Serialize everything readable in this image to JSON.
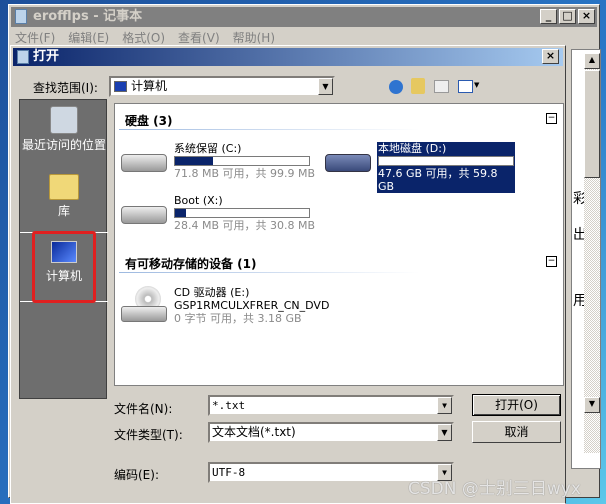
{
  "notepad": {
    "title": "erofflps - 记事本",
    "menu": [
      "文件(F)",
      "编辑(E)",
      "格式(O)",
      "查看(V)",
      "帮助(H)"
    ],
    "text_fragments": [
      "彩",
      "出",
      "用"
    ]
  },
  "dialog": {
    "title": "打开",
    "look_in_label": "查找范围(I):",
    "look_in_value": "计算机",
    "places": [
      {
        "label": "最近访问的位置",
        "icon": "recent-places-icon"
      },
      {
        "label": "库",
        "icon": "library-icon"
      },
      {
        "label": "计算机",
        "icon": "computer-icon",
        "selected": true
      }
    ],
    "groups": [
      {
        "title": "硬盘 (3)",
        "drives": [
          {
            "name": "系统保留 (C:)",
            "info": "71.8 MB 可用，共 99.9 MB",
            "used_fraction": 0.28
          },
          {
            "name": "本地磁盘 (D:)",
            "info": "47.6 GB 可用，共 59.8 GB",
            "used_fraction": 0.2,
            "selected": true
          },
          {
            "name": "Boot (X:)",
            "info": "28.4 MB 可用，共 30.8 MB",
            "used_fraction": 0.08
          }
        ]
      },
      {
        "title": "有可移动存储的设备 (1)",
        "drives": [
          {
            "name": "CD 驱动器 (E:)",
            "label": "GSP1RMCULXFRER_CN_DVD",
            "info": "0 字节 可用，共 3.18 GB"
          }
        ]
      }
    ],
    "filename_label": "文件名(N):",
    "filename_value": "*.txt",
    "filetype_label": "文件类型(T):",
    "filetype_value": "文本文档(*.txt)",
    "encoding_label": "编码(E):",
    "encoding_value": "UTF-8",
    "open_button": "打开(O)",
    "cancel_button": "取消"
  },
  "watermark": "CSDN @士别三日wyx",
  "colors": {
    "selection": "#0a246a",
    "highlight_box": "#e02020"
  }
}
